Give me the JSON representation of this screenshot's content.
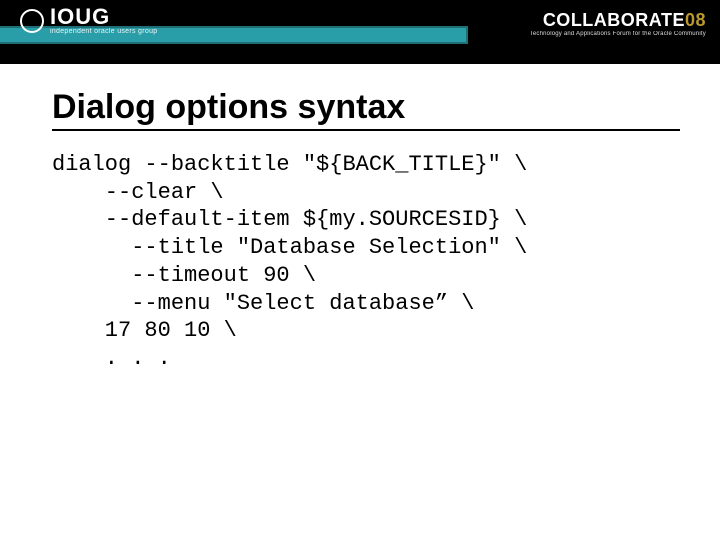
{
  "header": {
    "ioug_text": "IOUG",
    "ioug_sub": "independent oracle users group",
    "collab_prefix": "COLLABORATE",
    "collab_year": "08",
    "collab_sub": "Technology and Applications Forum for the Oracle Community"
  },
  "title": "Dialog options syntax",
  "code": "dialog --backtitle \"${BACK_TITLE}\" \\\n    --clear \\\n    --default-item ${my.SOURCESID} \\\n      --title \"Database Selection\" \\\n      --timeout 90 \\\n      --menu \"Select database” \\\n    17 80 10 \\\n    . . ."
}
